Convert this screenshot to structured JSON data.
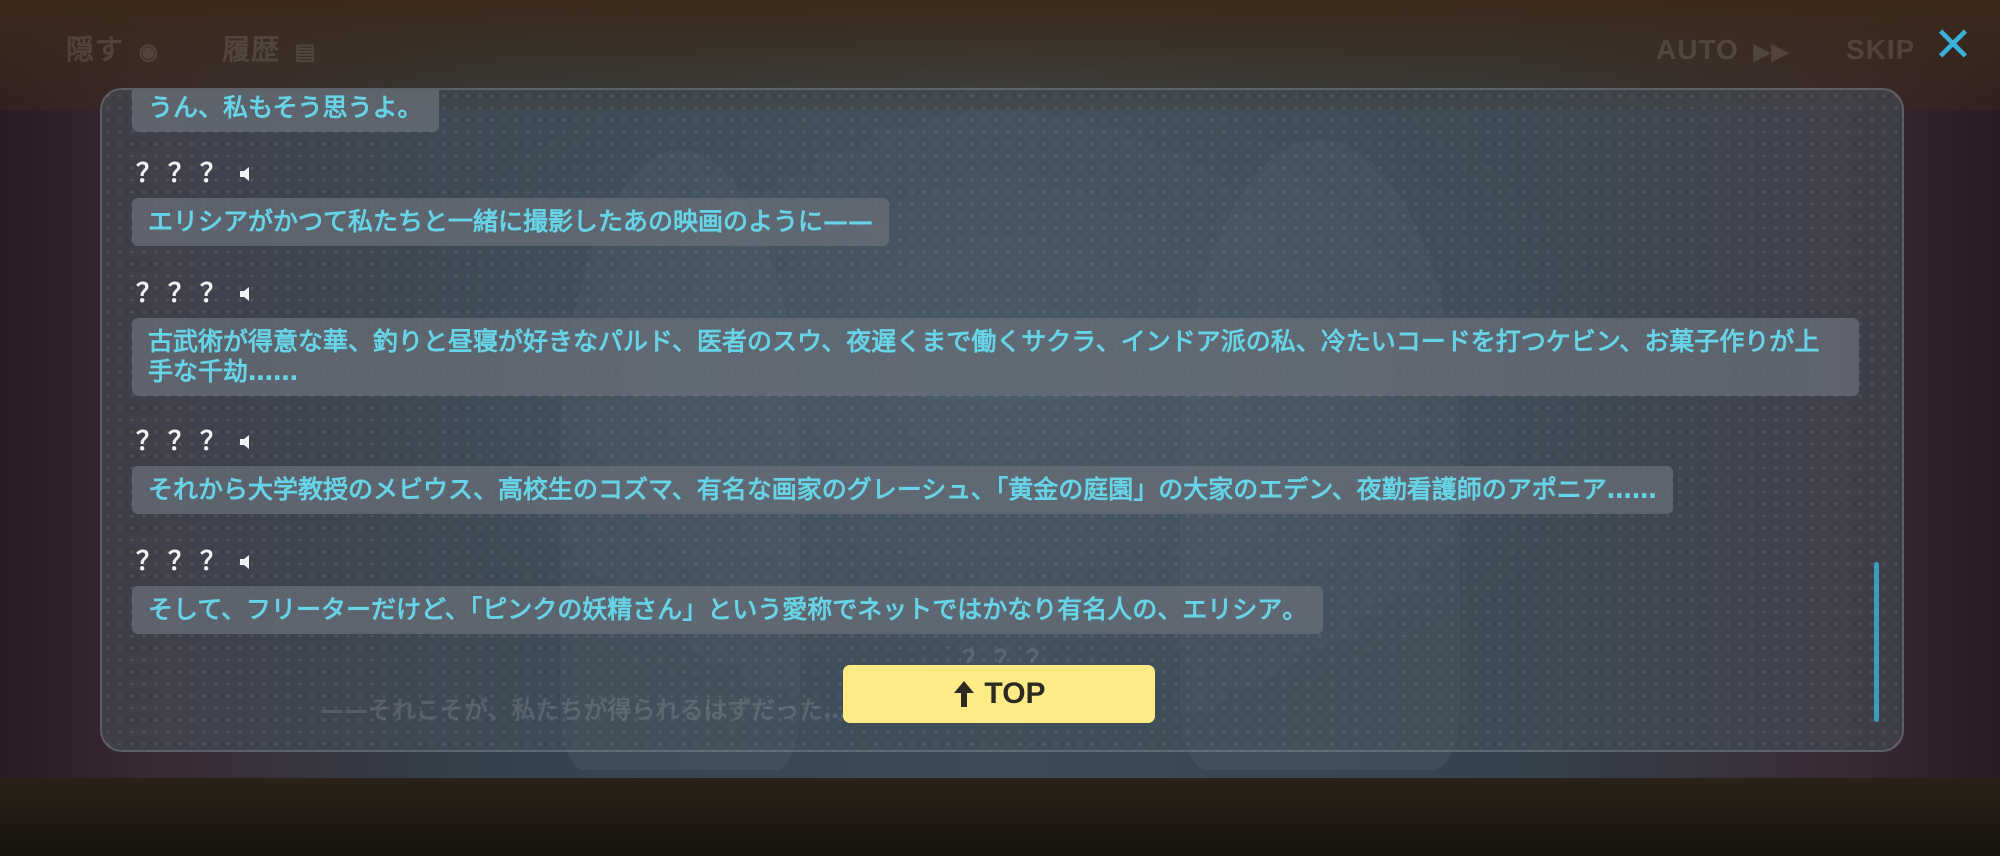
{
  "topbar": {
    "hide_label": "隠す",
    "history_label": "履歴",
    "auto_label": "AUTO",
    "skip_label": "SKIP",
    "close_glyph": "✕"
  },
  "colors": {
    "dialogue_text": "#66d4e6",
    "speaker_text": "#f2f2f2",
    "top_button": "#fdec86",
    "close_icon": "#3ab0d8"
  },
  "log": {
    "entries": [
      {
        "speaker": "",
        "text": "うん、私もそう思うよ。"
      },
      {
        "speaker": "？？？",
        "text": "エリシアがかつて私たちと一緒に撮影したあの映画のように——"
      },
      {
        "speaker": "？？？",
        "text": "古武術が得意な華、釣りと昼寝が好きなパルド、医者のスウ、夜遅くまで働くサクラ、インドア派の私、冷たいコードを打つケビン、お菓子作りが上手な千劫……"
      },
      {
        "speaker": "？？？",
        "text": "それから大学教授のメビウス、高校生のコズマ、有名な画家のグレーシュ、「黄金の庭園」の大家のエデン、夜勤看護師のアポニア……"
      },
      {
        "speaker": "？？？",
        "text": "そして、フリーターだけど、「ピンクの妖精さん」という愛称でネットではかなり有名人の、エリシア。"
      }
    ],
    "faded_speaker": "？？？",
    "faded_text": "——それこそが、私たちが得られるはずだった……でしょ？"
  },
  "top_button": {
    "label": "TOP",
    "icon": "arrow-up-icon"
  }
}
